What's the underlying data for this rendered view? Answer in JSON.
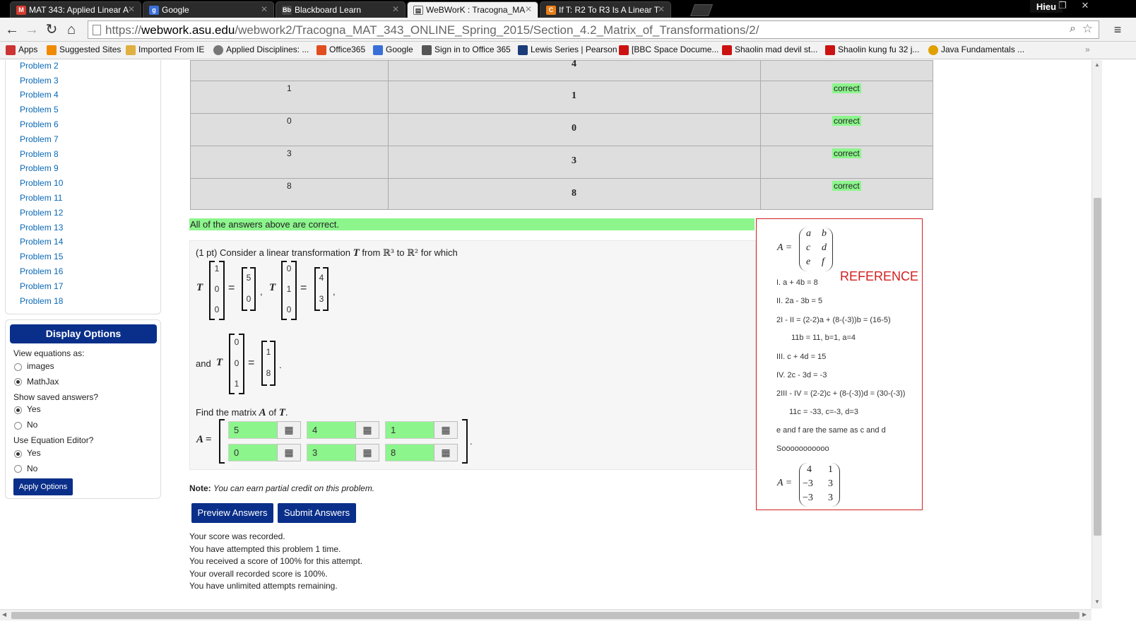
{
  "browser": {
    "tabs": [
      {
        "label": "MAT 343: Applied Linear A",
        "icon": "gmail-icon",
        "color": "#d43b2f"
      },
      {
        "label": "Google",
        "icon": "google-icon",
        "color": "#3a6fd8"
      },
      {
        "label": "Blackboard Learn",
        "icon": "blackboard-icon",
        "color": "#444444"
      },
      {
        "label": "WeBWorK : Tracogna_MA",
        "icon": "page-icon",
        "color": "#ffffff"
      },
      {
        "label": "If T: R2 To R3 Is A Linear T",
        "icon": "chegg-icon",
        "color": "#e67e1a"
      }
    ],
    "user": "Hieu",
    "window_min": "–",
    "window_max": "❐",
    "window_close": "✕",
    "url_scheme": "https://",
    "url_host": "webwork.asu.edu",
    "url_path": "/webwork2/Tracogna_MAT_343_ONLINE_Spring_2015/Section_4.2_Matrix_of_Transformations/2/",
    "bookmarks": [
      {
        "label": "Apps",
        "color": "#cc3333"
      },
      {
        "label": "Suggested Sites",
        "color": "#f08a00"
      },
      {
        "label": "Imported From IE",
        "color": "#e0b040"
      },
      {
        "label": "Applied Disciplines: ...",
        "color": "#777777"
      },
      {
        "label": "Office365",
        "color": "#e04d1e"
      },
      {
        "label": "Google",
        "color": "#3a6fd8"
      },
      {
        "label": "Sign in to Office 365",
        "color": "#555555"
      },
      {
        "label": "Lewis Series | Pearson",
        "color": "#1a3c78"
      },
      {
        "label": "[BBC Space Docume...",
        "color": "#cc1111"
      },
      {
        "label": "Shaolin mad devil st...",
        "color": "#cc1111"
      },
      {
        "label": "Shaolin kung fu 32 j...",
        "color": "#cc1111"
      },
      {
        "label": "Java Fundamentals ...",
        "color": "#e0a000"
      }
    ],
    "more_bookmarks": "»"
  },
  "sidebar": {
    "problems": [
      "Problem 2",
      "Problem 3",
      "Problem 4",
      "Problem 5",
      "Problem 6",
      "Problem 7",
      "Problem 8",
      "Problem 9",
      "Problem 10",
      "Problem 11",
      "Problem 12",
      "Problem 13",
      "Problem 14",
      "Problem 15",
      "Problem 16",
      "Problem 17",
      "Problem 18"
    ]
  },
  "display_options": {
    "title": "Display Options",
    "view_label": "View equations as:",
    "view_options": [
      "images",
      "MathJax"
    ],
    "view_selected": "MathJax",
    "saved_label": "Show saved answers?",
    "saved_options": [
      "Yes",
      "No"
    ],
    "saved_selected": "Yes",
    "editor_label": "Use Equation Editor?",
    "editor_options": [
      "Yes",
      "No"
    ],
    "editor_selected": "Yes",
    "apply": "Apply Options"
  },
  "results_table": {
    "rows": [
      {
        "entered": "",
        "preview": "4",
        "result": ""
      },
      {
        "entered": "1",
        "preview": "1",
        "result": "correct"
      },
      {
        "entered": "0",
        "preview": "0",
        "result": "correct"
      },
      {
        "entered": "3",
        "preview": "3",
        "result": "correct"
      },
      {
        "entered": "8",
        "preview": "8",
        "result": "correct"
      }
    ]
  },
  "all_correct": "All of the answers above are correct.",
  "problem": {
    "intro": "(1 pt) Consider a linear transformation",
    "T": "T",
    "from": "from",
    "R3": "ℝ³",
    "to": "to",
    "R2": "ℝ²",
    "for_which": "for which",
    "and": "and",
    "equals": "=",
    "comma": ",",
    "period": ".",
    "e1": [
      "1",
      "0",
      "0"
    ],
    "e2": [
      "0",
      "1",
      "0"
    ],
    "e3": [
      "0",
      "0",
      "1"
    ],
    "Te1": [
      "5",
      "0"
    ],
    "Te2": [
      "4",
      "3"
    ],
    "Te3": [
      "1",
      "8"
    ],
    "find_prefix": "Find the matrix",
    "find_A": "A",
    "find_of": "of",
    "find_T": "T",
    "A_label": "A =",
    "answers": [
      [
        "5",
        "4",
        "1"
      ],
      [
        "0",
        "3",
        "8"
      ]
    ],
    "eq_icon": "▦"
  },
  "note_label": "Note:",
  "note_text": "You can earn partial credit on this problem.",
  "buttons": {
    "preview": "Preview Answers",
    "submit": "Submit Answers"
  },
  "score_lines": [
    "Your score was recorded.",
    "You have attempted this problem 1 time.",
    "You received a score of 100% for this attempt.",
    "Your overall recorded score is 100%.",
    "You have unlimited attempts remaining."
  ],
  "reference": {
    "title": "REFERENCE",
    "A_label": "A =",
    "matrix_sym": [
      [
        "a",
        "b"
      ],
      [
        "c",
        "d"
      ],
      [
        "e",
        "f"
      ]
    ],
    "lines": [
      "I. a + 4b = 8",
      "II. 2a - 3b = 5",
      "2I - II = (2-2)a + (8-(-3))b = (16-5)",
      "11b = 11, b=1, a=4",
      "III. c + 4d = 15",
      "IV. 2c - 3d = -3",
      "2III - IV = (2-2)c + (8-(-3))d = (30-(-3))",
      "11c = -33, c=-3, d=3",
      "e and f are the same as c and d",
      "Sooooooooooo"
    ],
    "matrix_result": [
      [
        "4",
        "1"
      ],
      [
        "−3",
        "3"
      ],
      [
        "−3",
        "3"
      ]
    ]
  }
}
